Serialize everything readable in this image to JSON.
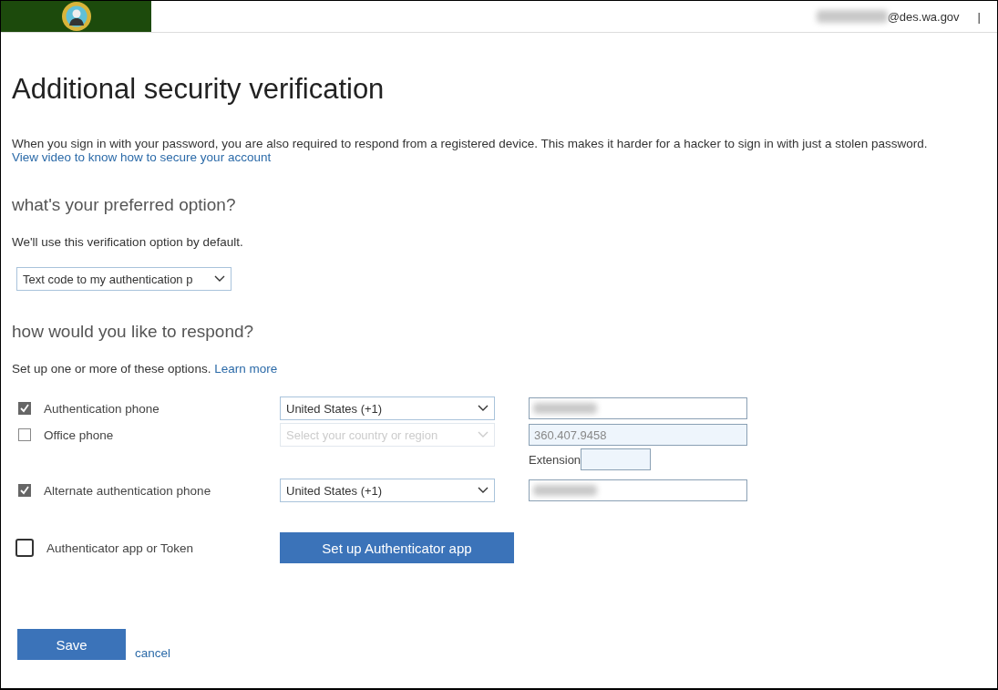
{
  "header": {
    "user_email": "@des.wa.gov",
    "user_redacted": true,
    "separator": "|"
  },
  "title": "Additional security verification",
  "intro": "When you sign in with your password, you are also required to respond from a registered device. This makes it harder for a hacker to sign in with just a stolen password.",
  "video_link": "View video to know how to secure your account",
  "preferred": {
    "heading": "what's your preferred option?",
    "note": "We'll use this verification option by default.",
    "value": "Text code to my authentication p"
  },
  "respond": {
    "heading": "how would you like to respond?",
    "note": "Set up one or more of these options.",
    "learn_more": "Learn more"
  },
  "methods": [
    {
      "kind": "phone",
      "label": "Authentication phone",
      "checked": true,
      "disabled": false,
      "country": {
        "value": "United States (+1)"
      },
      "phone": {
        "redacted": true
      }
    },
    {
      "kind": "phone",
      "label": "Office phone",
      "checked": false,
      "disabled": true,
      "country": {
        "placeholder": "Select your country or region"
      },
      "phone": {
        "value": "360.407.9458"
      },
      "extension": {
        "label": "Extension"
      }
    },
    {
      "kind": "phone",
      "label": "Alternate authentication phone",
      "checked": true,
      "disabled": false,
      "country": {
        "value": "United States (+1)"
      },
      "phone": {
        "redacted": true
      }
    },
    {
      "kind": "app",
      "label": "Authenticator app or Token",
      "checked": false,
      "button": "Set up Authenticator app"
    }
  ],
  "actions": {
    "save": "Save",
    "cancel": "cancel"
  }
}
